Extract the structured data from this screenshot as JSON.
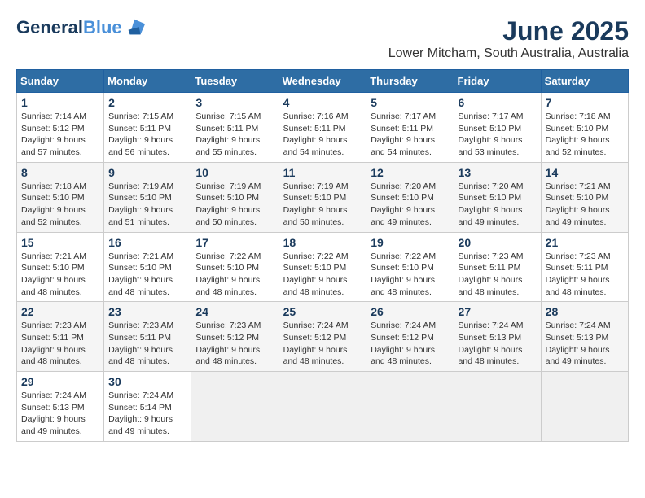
{
  "logo": {
    "line1": "General",
    "line2": "Blue"
  },
  "title": "June 2025",
  "subtitle": "Lower Mitcham, South Australia, Australia",
  "days_of_week": [
    "Sunday",
    "Monday",
    "Tuesday",
    "Wednesday",
    "Thursday",
    "Friday",
    "Saturday"
  ],
  "weeks": [
    [
      {
        "day": "1",
        "sunrise": "7:14 AM",
        "sunset": "5:12 PM",
        "daylight": "9 hours and 57 minutes."
      },
      {
        "day": "2",
        "sunrise": "7:15 AM",
        "sunset": "5:11 PM",
        "daylight": "9 hours and 56 minutes."
      },
      {
        "day": "3",
        "sunrise": "7:15 AM",
        "sunset": "5:11 PM",
        "daylight": "9 hours and 55 minutes."
      },
      {
        "day": "4",
        "sunrise": "7:16 AM",
        "sunset": "5:11 PM",
        "daylight": "9 hours and 54 minutes."
      },
      {
        "day": "5",
        "sunrise": "7:17 AM",
        "sunset": "5:11 PM",
        "daylight": "9 hours and 54 minutes."
      },
      {
        "day": "6",
        "sunrise": "7:17 AM",
        "sunset": "5:10 PM",
        "daylight": "9 hours and 53 minutes."
      },
      {
        "day": "7",
        "sunrise": "7:18 AM",
        "sunset": "5:10 PM",
        "daylight": "9 hours and 52 minutes."
      }
    ],
    [
      {
        "day": "8",
        "sunrise": "7:18 AM",
        "sunset": "5:10 PM",
        "daylight": "9 hours and 52 minutes."
      },
      {
        "day": "9",
        "sunrise": "7:19 AM",
        "sunset": "5:10 PM",
        "daylight": "9 hours and 51 minutes."
      },
      {
        "day": "10",
        "sunrise": "7:19 AM",
        "sunset": "5:10 PM",
        "daylight": "9 hours and 50 minutes."
      },
      {
        "day": "11",
        "sunrise": "7:19 AM",
        "sunset": "5:10 PM",
        "daylight": "9 hours and 50 minutes."
      },
      {
        "day": "12",
        "sunrise": "7:20 AM",
        "sunset": "5:10 PM",
        "daylight": "9 hours and 49 minutes."
      },
      {
        "day": "13",
        "sunrise": "7:20 AM",
        "sunset": "5:10 PM",
        "daylight": "9 hours and 49 minutes."
      },
      {
        "day": "14",
        "sunrise": "7:21 AM",
        "sunset": "5:10 PM",
        "daylight": "9 hours and 49 minutes."
      }
    ],
    [
      {
        "day": "15",
        "sunrise": "7:21 AM",
        "sunset": "5:10 PM",
        "daylight": "9 hours and 48 minutes."
      },
      {
        "day": "16",
        "sunrise": "7:21 AM",
        "sunset": "5:10 PM",
        "daylight": "9 hours and 48 minutes."
      },
      {
        "day": "17",
        "sunrise": "7:22 AM",
        "sunset": "5:10 PM",
        "daylight": "9 hours and 48 minutes."
      },
      {
        "day": "18",
        "sunrise": "7:22 AM",
        "sunset": "5:10 PM",
        "daylight": "9 hours and 48 minutes."
      },
      {
        "day": "19",
        "sunrise": "7:22 AM",
        "sunset": "5:10 PM",
        "daylight": "9 hours and 48 minutes."
      },
      {
        "day": "20",
        "sunrise": "7:23 AM",
        "sunset": "5:11 PM",
        "daylight": "9 hours and 48 minutes."
      },
      {
        "day": "21",
        "sunrise": "7:23 AM",
        "sunset": "5:11 PM",
        "daylight": "9 hours and 48 minutes."
      }
    ],
    [
      {
        "day": "22",
        "sunrise": "7:23 AM",
        "sunset": "5:11 PM",
        "daylight": "9 hours and 48 minutes."
      },
      {
        "day": "23",
        "sunrise": "7:23 AM",
        "sunset": "5:11 PM",
        "daylight": "9 hours and 48 minutes."
      },
      {
        "day": "24",
        "sunrise": "7:23 AM",
        "sunset": "5:12 PM",
        "daylight": "9 hours and 48 minutes."
      },
      {
        "day": "25",
        "sunrise": "7:24 AM",
        "sunset": "5:12 PM",
        "daylight": "9 hours and 48 minutes."
      },
      {
        "day": "26",
        "sunrise": "7:24 AM",
        "sunset": "5:12 PM",
        "daylight": "9 hours and 48 minutes."
      },
      {
        "day": "27",
        "sunrise": "7:24 AM",
        "sunset": "5:13 PM",
        "daylight": "9 hours and 48 minutes."
      },
      {
        "day": "28",
        "sunrise": "7:24 AM",
        "sunset": "5:13 PM",
        "daylight": "9 hours and 49 minutes."
      }
    ],
    [
      {
        "day": "29",
        "sunrise": "7:24 AM",
        "sunset": "5:13 PM",
        "daylight": "9 hours and 49 minutes."
      },
      {
        "day": "30",
        "sunrise": "7:24 AM",
        "sunset": "5:14 PM",
        "daylight": "9 hours and 49 minutes."
      },
      null,
      null,
      null,
      null,
      null
    ]
  ]
}
